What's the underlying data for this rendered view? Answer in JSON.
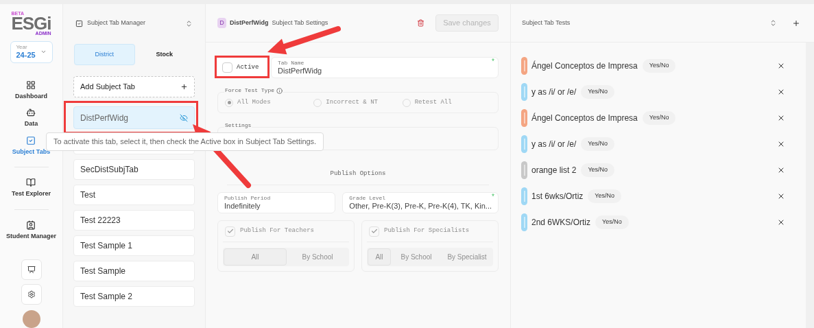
{
  "sidebar": {
    "logo": {
      "beta": "BETA",
      "name": "ESGi",
      "edition": "ADMIN"
    },
    "year": {
      "label": "Year",
      "value": "24-25"
    },
    "nav": [
      {
        "kind": "dashboard",
        "label": "Dashboard",
        "selected": false
      },
      {
        "kind": "data",
        "label": "Data",
        "selected": false
      },
      {
        "kind": "subject-tabs",
        "label": "Subject Tabs",
        "selected": true
      },
      {
        "kind": "test-explorer",
        "label": "Test Explorer",
        "selected": false
      },
      {
        "kind": "student-manager",
        "label": "Student Manager",
        "selected": false
      }
    ],
    "tools": [
      {
        "kind": "monitor"
      },
      {
        "kind": "settings"
      }
    ]
  },
  "tab_manager": {
    "title": "Subject Tab Manager",
    "tabs": [
      {
        "label": "District",
        "selected": true
      },
      {
        "label": "Stock",
        "selected": false
      }
    ],
    "add_button": "Add Subject Tab",
    "items": [
      {
        "kind": "tab",
        "label": "DistPerfWidg",
        "selected": true,
        "hidden": true
      },
      {
        "kind": "covered"
      },
      {
        "kind": "tab",
        "label": "SecDistSubjTab",
        "selected": false,
        "hidden": false
      },
      {
        "kind": "tab",
        "label": "Test",
        "selected": false,
        "hidden": false
      },
      {
        "kind": "tab",
        "label": "Test 22223",
        "selected": false,
        "hidden": false
      },
      {
        "kind": "tab",
        "label": "Test Sample 1",
        "selected": false,
        "hidden": false
      },
      {
        "kind": "tab",
        "label": "Test Sample",
        "selected": false,
        "hidden": false
      },
      {
        "kind": "tab",
        "label": "Test Sample 2",
        "selected": false,
        "hidden": false
      }
    ],
    "tooltip": "To activate this tab, select it, then check the Active box in Subject Tab Settings."
  },
  "settings_panel": {
    "badge": "D",
    "tab_name": "DistPerfWidg",
    "title": "Subject Tab Settings",
    "save_button": {
      "label": "Save changes",
      "disabled": true
    },
    "active": {
      "label": "Active",
      "checked": false
    },
    "name_field": {
      "label": "Tab Name",
      "value": "DistPerfWidg",
      "required_mark": "*"
    },
    "force_test_type": {
      "label": "Force Test Type",
      "options": [
        {
          "label": "All Modes",
          "selected": true
        },
        {
          "label": "Incorrect & NT",
          "selected": false
        },
        {
          "label": "Retest All",
          "selected": false
        }
      ]
    },
    "settings": {
      "label": "Settings"
    },
    "publish_options": {
      "title": "Publish Options",
      "period": {
        "label": "Publish Period",
        "value": "Indefinitely"
      },
      "grade_level": {
        "label": "Grade Level",
        "value": "Other, Pre-K(3), Pre-K, Pre-K(4), TK, Kin...",
        "required_mark": "*"
      },
      "groups": [
        {
          "label": "Publish For Teachers",
          "checked": true,
          "options": [
            {
              "label": "All",
              "selected": true
            },
            {
              "label": "By School",
              "selected": false
            }
          ]
        },
        {
          "label": "Publish For Specialists",
          "checked": true,
          "options": [
            {
              "label": "All",
              "selected": true
            },
            {
              "label": "By School",
              "selected": false
            },
            {
              "label": "By Specialist",
              "selected": false
            }
          ]
        }
      ]
    }
  },
  "tests_panel": {
    "title": "Subject Tab Tests",
    "tests": [
      {
        "name": "Ángel Conceptos de Impresa",
        "type": "Yes/No",
        "color": "#f4a582"
      },
      {
        "name": "y as /i/ or /e/",
        "type": "Yes/No",
        "color": "#9fd8f5"
      },
      {
        "name": "Ángel Conceptos de Impresa",
        "type": "Yes/No",
        "color": "#f4a582"
      },
      {
        "name": "y as /i/ or /e/",
        "type": "Yes/No",
        "color": "#9fd8f5"
      },
      {
        "name": "orange list 2",
        "type": "Yes/No",
        "color": "#c8c8c8"
      },
      {
        "name": "1st 6wks/Ortiz",
        "type": "Yes/No",
        "color": "#9fd8f5"
      },
      {
        "name": "2nd 6WKS/Ortiz",
        "type": "Yes/No",
        "color": "#9fd8f5"
      }
    ]
  }
}
